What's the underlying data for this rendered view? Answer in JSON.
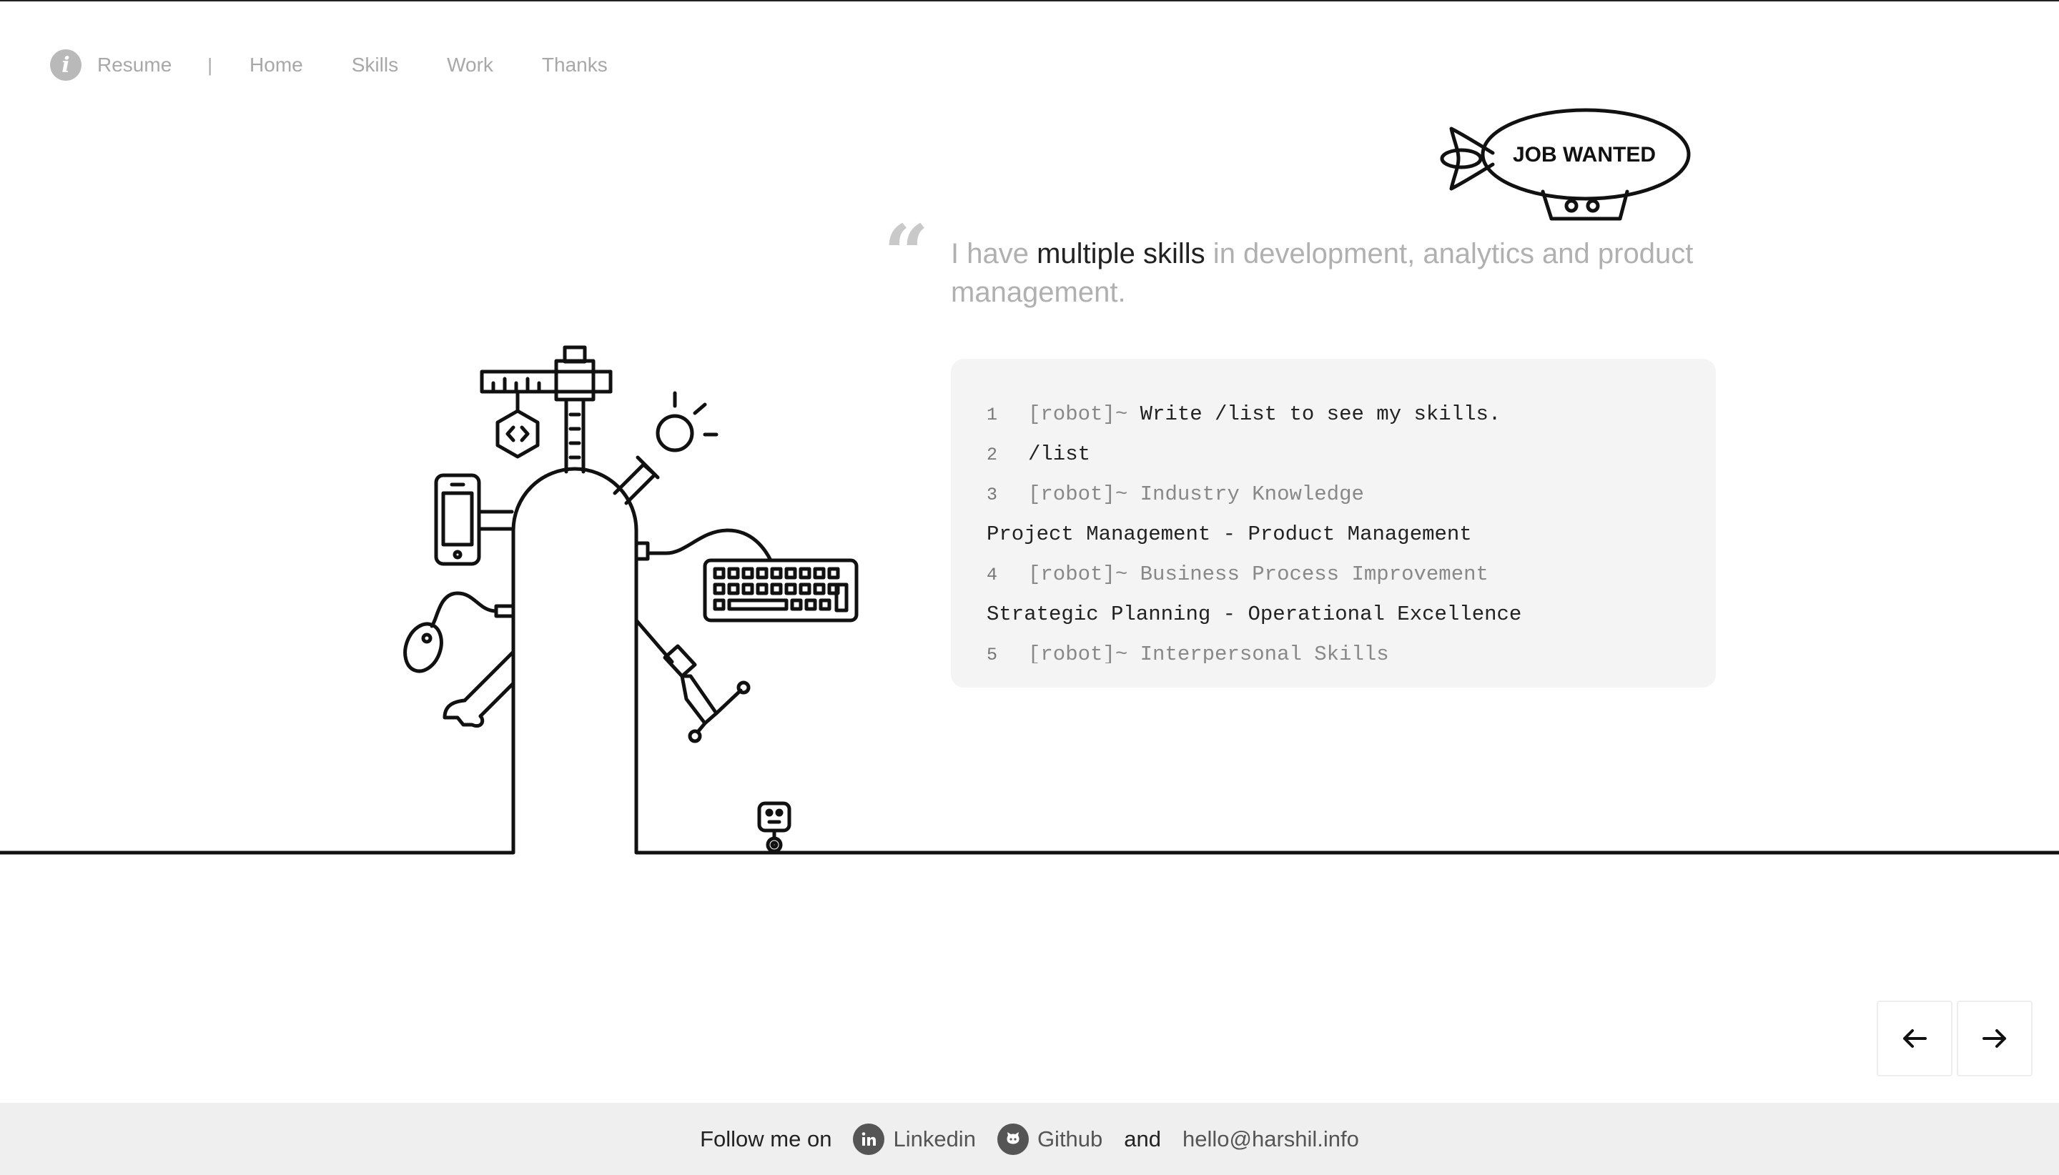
{
  "nav": {
    "resume": "Resume",
    "separator": "|",
    "items": [
      "Home",
      "Skills",
      "Work",
      "Thanks"
    ]
  },
  "blimp": {
    "label": "JOB WANTED"
  },
  "quote": {
    "mark": "“",
    "before": "I have ",
    "highlight": "multiple skills",
    "after": " in development, analytics and product management."
  },
  "terminal": {
    "lines": [
      {
        "num": "1",
        "prompt": "[robot]~",
        "text": "Write /list to see my skills."
      },
      {
        "num": "2",
        "text": "/list"
      },
      {
        "num": "3",
        "prompt": "[robot]~",
        "text": "Industry Knowledge"
      },
      {
        "output": "Project Management - Product Management"
      },
      {
        "num": "4",
        "prompt": "[robot]~",
        "text": "Business Process Improvement"
      },
      {
        "output": "Strategic Planning - Operational Excellence"
      },
      {
        "num": "5",
        "prompt": "[robot]~",
        "text": "Interpersonal Skills"
      }
    ]
  },
  "arrows": {
    "prev": "prev",
    "next": "next"
  },
  "footer": {
    "follow": "Follow me on",
    "linkedin": "Linkedin",
    "github": "Github",
    "and": "and",
    "email": "hello@harshil.info"
  },
  "icons": {
    "info": "info-icon",
    "linkedin": "linkedin-icon",
    "github": "github-icon",
    "arrow_left": "arrow-left-icon",
    "arrow_right": "arrow-right-icon"
  }
}
